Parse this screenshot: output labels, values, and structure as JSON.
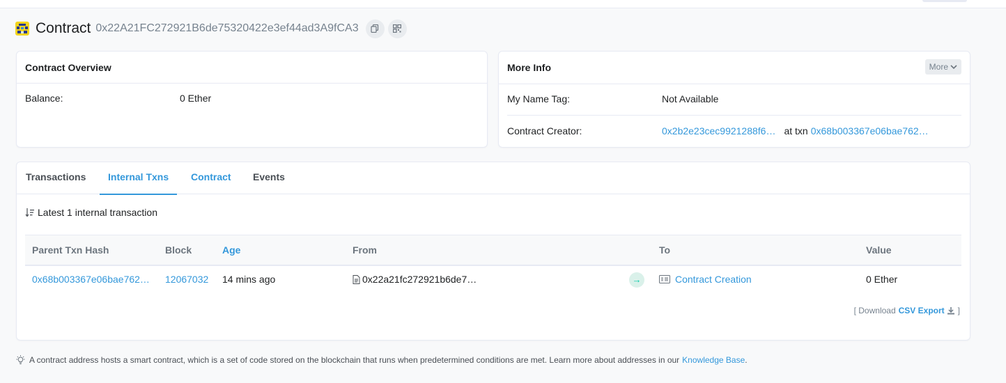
{
  "header": {
    "title": "Contract",
    "address": "0x22A21FC272921B6de75320422e3ef44ad3A9fCA3"
  },
  "overview": {
    "title": "Contract Overview",
    "balance_label": "Balance:",
    "balance_value": "0 Ether"
  },
  "more_info": {
    "title": "More Info",
    "more_button": "More",
    "name_tag_label": "My Name Tag:",
    "name_tag_value": "Not Available",
    "creator_label": "Contract Creator:",
    "creator_address": "0x2b2e23cec9921288f6…",
    "at_txn_text": "at txn",
    "creator_txn": "0x68b003367e06bae762…"
  },
  "tabs": [
    {
      "label": "Transactions"
    },
    {
      "label": "Internal Txns"
    },
    {
      "label": "Contract"
    },
    {
      "label": "Events"
    }
  ],
  "summary": "Latest 1 internal transaction",
  "table": {
    "headers": [
      "Parent Txn Hash",
      "Block",
      "Age",
      "From",
      "To",
      "Value"
    ],
    "rows": [
      {
        "parent_txn_hash": "0x68b003367e06bae762…",
        "block": "12067032",
        "age": "14 mins ago",
        "from": "0x22a21fc272921b6de7…",
        "to": "Contract Creation",
        "value": "0 Ether"
      }
    ]
  },
  "export": {
    "open_bracket": "[ Download",
    "link_label": "CSV Export",
    "close_bracket": "]"
  },
  "footer": {
    "text": "A contract address hosts a smart contract, which is a set of code stored on the blockchain that runs when predetermined conditions are met. Learn more about addresses in our",
    "link": "Knowledge Base",
    "end": "."
  },
  "colors": {
    "link": "#3498db",
    "text": "#1e2022",
    "muted": "#77838f",
    "border": "#e7eaf3",
    "success": "#00c9a7"
  },
  "icons": [
    "identicon-avatar",
    "copy-icon",
    "qr-code-icon",
    "chevron-down-icon",
    "sort-icon",
    "file-icon",
    "arrow-right-icon",
    "contract-creation-icon",
    "download-icon",
    "lightbulb-icon"
  ]
}
